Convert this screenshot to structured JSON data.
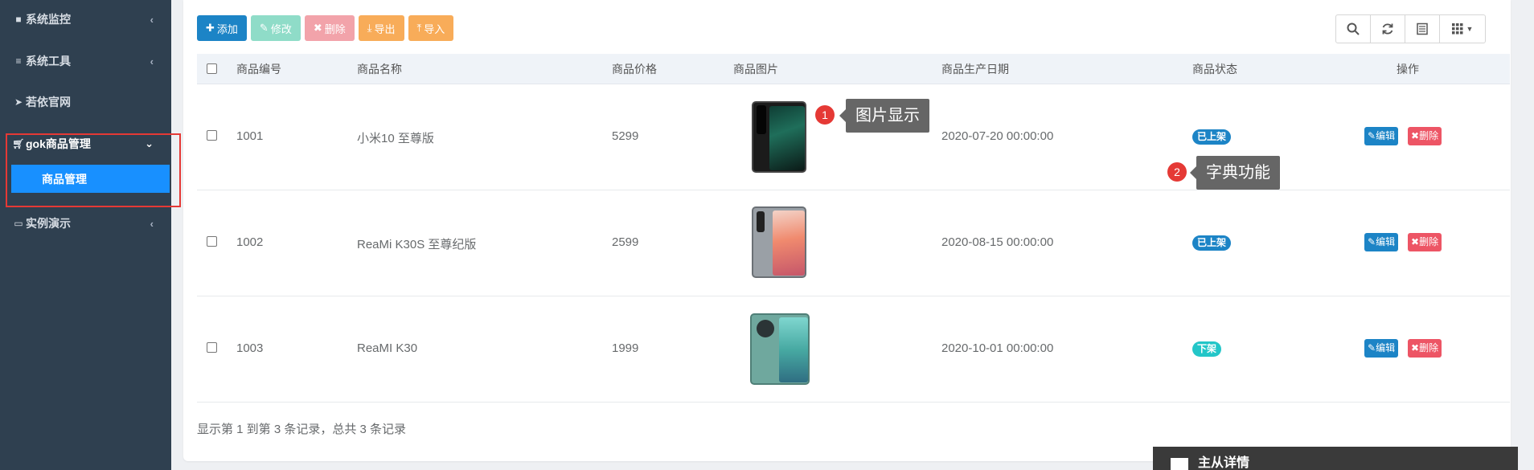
{
  "sidebar": {
    "items": [
      {
        "label": "系统监控",
        "icon": "video-camera-icon",
        "has_chevron": true
      },
      {
        "label": "系统工具",
        "icon": "bars-icon",
        "has_chevron": true
      },
      {
        "label": "若依官网",
        "icon": "send-icon",
        "has_chevron": false
      },
      {
        "label": "gok商品管理",
        "icon": "shopping-cart-icon",
        "has_chevron": true,
        "expanded": true
      },
      {
        "label": "实例演示",
        "icon": "desktop-icon",
        "has_chevron": true
      }
    ],
    "sub_item": {
      "label": "商品管理",
      "active": true
    }
  },
  "toolbar": {
    "add": "添加",
    "edit": "修改",
    "delete": "删除",
    "export": "导出",
    "import": "导入"
  },
  "tools_right": [
    "search-icon",
    "refresh-icon",
    "columns-toggle-icon",
    "grid-menu-icon"
  ],
  "table": {
    "headers": [
      "商品编号",
      "商品名称",
      "商品价格",
      "商品图片",
      "商品生产日期",
      "商品状态",
      "操作"
    ],
    "rows": [
      {
        "id": "1001",
        "name": "小米10 至尊版",
        "price": "5299",
        "date": "2020-07-20 00:00:00",
        "status": "已上架",
        "image": "black-phone"
      },
      {
        "id": "1002",
        "name": "ReaMi K30S 至尊纪版",
        "price": "2599",
        "date": "2020-08-15 00:00:00",
        "status": "已上架",
        "image": "silver-phone"
      },
      {
        "id": "1003",
        "name": "ReaMI K30",
        "price": "1999",
        "date": "2020-10-01 00:00:00",
        "status": "下架",
        "image": "teal-phone"
      }
    ],
    "actions": {
      "edit": "编辑",
      "delete": "删除"
    }
  },
  "footer": {
    "info": "显示第 1 到第 3 条记录，总共 3 条记录"
  },
  "callouts": [
    {
      "num": "1",
      "text": "图片显示"
    },
    {
      "num": "2",
      "text": "字典功能"
    }
  ],
  "popup": {
    "text": "主从详情"
  },
  "colors": {
    "sidebar_bg": "#2f4050",
    "active_blue": "#1890ff",
    "primary": "#1c84c6",
    "danger": "#ed5565",
    "warning": "#f8ac59",
    "info": "#23c6c8",
    "highlight_red": "#e53935"
  }
}
